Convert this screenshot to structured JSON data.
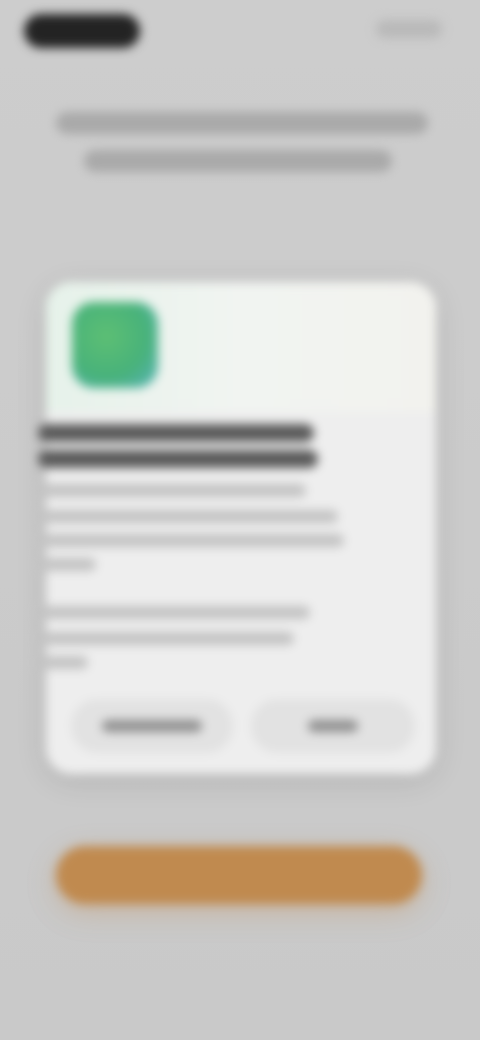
{
  "top_bar": {
    "left_pill_label": "",
    "right_link_label": ""
  },
  "heading": {
    "line1": "",
    "line2": ""
  },
  "card": {
    "title_line1": "",
    "title_line2": "",
    "body": [
      "",
      "",
      "",
      "",
      "",
      "",
      ""
    ],
    "secondary_button_label": "",
    "primary_button_label": ""
  },
  "cta": {
    "label": ""
  },
  "colors": {
    "background": "#cfcfcf",
    "card": "#eeeeee",
    "cta": "#c08a4f",
    "app_icon_green": "#48b27a",
    "app_icon_teal": "#58b3bd"
  },
  "icons": {
    "app_icon": "app-icon"
  }
}
